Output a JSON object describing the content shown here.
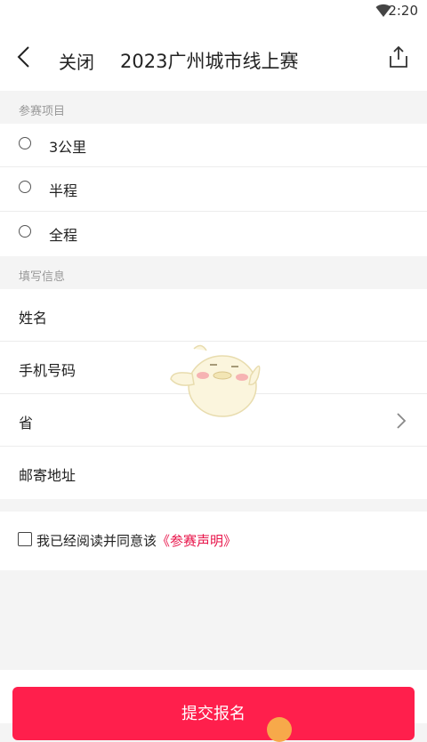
{
  "status_bar": {
    "time": "2:20"
  },
  "nav": {
    "close_label": "关闭",
    "title": "2023广州城市线上赛"
  },
  "sections": {
    "event_header": "参赛项目",
    "info_header": "填写信息"
  },
  "event_options": [
    "3公里",
    "半程",
    "全程"
  ],
  "form_fields": {
    "name": "姓名",
    "phone": "手机号码",
    "province": "省",
    "address": "邮寄地址"
  },
  "agreement": {
    "prefix": "我已经阅读并同意该",
    "link": "《参赛声明》"
  },
  "submit_label": "提交报名",
  "colors": {
    "accent": "#ff1f4c",
    "link": "#e8144a",
    "background": "#f4f4f4"
  }
}
